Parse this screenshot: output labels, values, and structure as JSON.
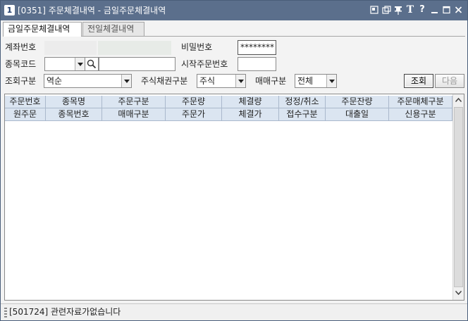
{
  "window": {
    "number": "1",
    "title": "[0351] 주문체결내역 - 금일주문체결내역",
    "icons": [
      "restore-layout-icon",
      "copy-window-icon",
      "pin-icon",
      "font-icon",
      "help-icon",
      "minimize-icon",
      "maximize-icon",
      "close-icon"
    ]
  },
  "tabs": [
    {
      "label": "금일주문체결내역",
      "active": true
    },
    {
      "label": "전일체결내역",
      "active": false
    }
  ],
  "form": {
    "account_label": "계좌번호",
    "password_label": "비밀번호",
    "password_value": "********",
    "stock_code_label": "종목코드",
    "start_order_label": "시작주문번호",
    "query_type_label": "조회구분",
    "query_type_value": "역순",
    "stock_bond_label": "주식채권구분",
    "stock_bond_value": "주식",
    "trade_type_label": "매매구분",
    "trade_type_value": "전체",
    "search_button": "조회",
    "next_button": "다음"
  },
  "grid": {
    "header_row1": [
      "주문번호",
      "종목명",
      "주문구분",
      "주문량",
      "체결량",
      "정정/취소",
      "주문잔량",
      "주문매체구분"
    ],
    "header_row2": [
      "원주문",
      "종목번호",
      "매매구분",
      "주문가",
      "체결가",
      "접수구분",
      "대출일",
      "신용구분"
    ]
  },
  "status": {
    "message": "[501724] 관련자료가없습니다"
  },
  "colors": {
    "titlebar": "#5b6f8c",
    "grid_header": "#dbe5f1"
  }
}
